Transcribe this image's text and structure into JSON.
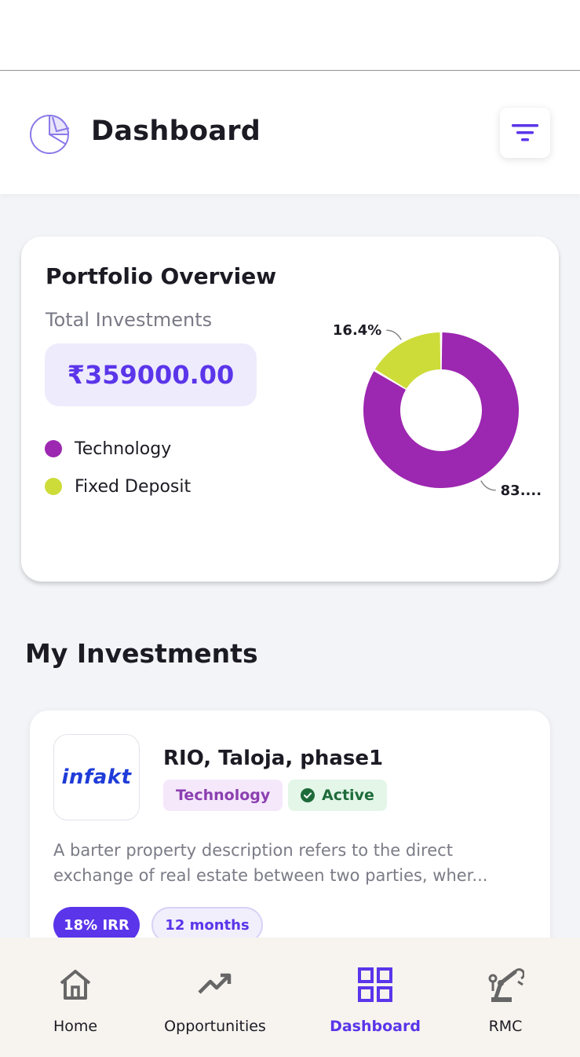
{
  "header": {
    "title": "Dashboard",
    "logo_icon": "pie-chart-icon",
    "filter_icon": "filter-icon"
  },
  "portfolio": {
    "title": "Portfolio Overview",
    "total_label": "Total Investments",
    "total_value": "₹359000.00",
    "legend": [
      {
        "label": "Technology",
        "color": "#9c27b0"
      },
      {
        "label": "Fixed Deposit",
        "color": "#cddc39"
      }
    ],
    "chart_data": {
      "type": "pie",
      "categories": [
        "Technology",
        "Fixed Deposit"
      ],
      "values": [
        83.6,
        16.4
      ],
      "data_labels": [
        "83....",
        "16.4%"
      ],
      "colors": [
        "#9c27b0",
        "#cddc39"
      ]
    }
  },
  "investments": {
    "section_title": "My Investments",
    "items": [
      {
        "logo_text": "infakt",
        "name": "RIO, Taloja, phase1",
        "category": "Technology",
        "status": "Active",
        "description": "A barter property description refers to the direct exchange of real estate between two parties, wher...",
        "irr": "18% IRR",
        "duration": "12 months"
      }
    ]
  },
  "nav": {
    "items": [
      {
        "label": "Home",
        "icon": "home-icon"
      },
      {
        "label": "Opportunities",
        "icon": "trending-up-icon"
      },
      {
        "label": "Dashboard",
        "icon": "grid-icon"
      },
      {
        "label": "RMC",
        "icon": "crane-icon"
      }
    ],
    "active_color": "#5a35ea"
  }
}
